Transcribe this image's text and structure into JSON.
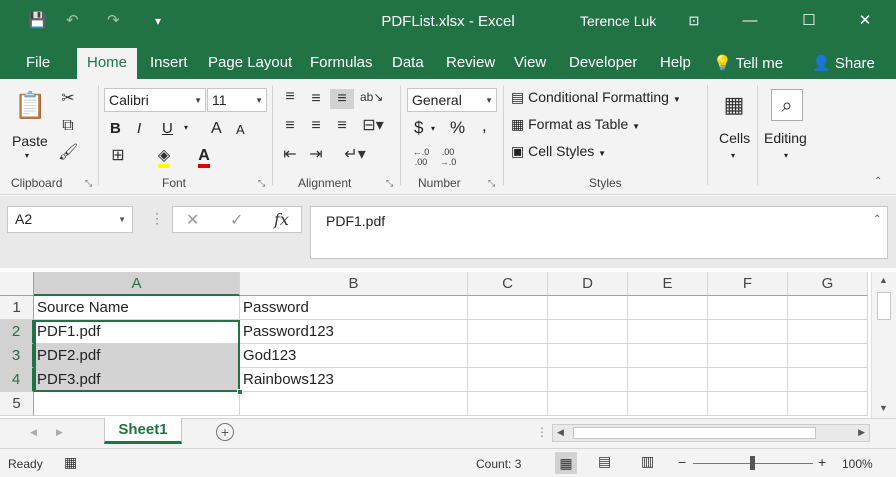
{
  "window": {
    "file_title": "PDFList.xlsx  -  Excel",
    "user_name": "Terence Luk",
    "minimize": "—",
    "maximize": "☐",
    "close": "✕"
  },
  "quick_access": {
    "save": "💾",
    "undo": "↶",
    "redo": "↷",
    "customize": "▾"
  },
  "tabs": [
    "File",
    "Home",
    "Insert",
    "Page Layout",
    "Formulas",
    "Data",
    "Review",
    "View",
    "Developer",
    "Help"
  ],
  "tell_me": "Tell me",
  "share": "Share",
  "ribbon": {
    "clipboard": {
      "label": "Clipboard",
      "paste": "Paste"
    },
    "font": {
      "label": "Font",
      "name": "Calibri",
      "size": "11",
      "bold": "B",
      "italic": "I",
      "underline": "U",
      "grow": "A",
      "shrink": "A"
    },
    "alignment": {
      "label": "Alignment"
    },
    "number": {
      "label": "Number",
      "format": "General",
      "currency": "$",
      "percent": "%",
      "comma": ","
    },
    "styles": {
      "label": "Styles",
      "conditional": "Conditional Formatting",
      "format_table": "Format as Table",
      "cell_styles": "Cell Styles"
    },
    "cells": {
      "label": "Cells"
    },
    "editing": {
      "label": "Editing"
    }
  },
  "formula_bar": {
    "name_box": "A2",
    "content": "PDF1.pdf",
    "cancel": "✕",
    "enter": "✓",
    "fx": "fx"
  },
  "columns": [
    "A",
    "B",
    "C",
    "D",
    "E",
    "F",
    "G"
  ],
  "rows": [
    "1",
    "2",
    "3",
    "4",
    "5"
  ],
  "cells": {
    "A1": "Source Name",
    "B1": "Password",
    "A2": "PDF1.pdf",
    "B2": "Password123",
    "A3": "PDF2.pdf",
    "B3": "God123",
    "A4": "PDF3.pdf",
    "B4": "Rainbows123"
  },
  "sheet_tabs": [
    "Sheet1"
  ],
  "add_sheet": "+",
  "status": {
    "mode": "Ready",
    "count": "Count: 3",
    "zoom": "100%",
    "zoom_minus": "−",
    "zoom_plus": "+"
  },
  "colors": {
    "accent": "#217346",
    "selection": "#d3d3d3"
  }
}
